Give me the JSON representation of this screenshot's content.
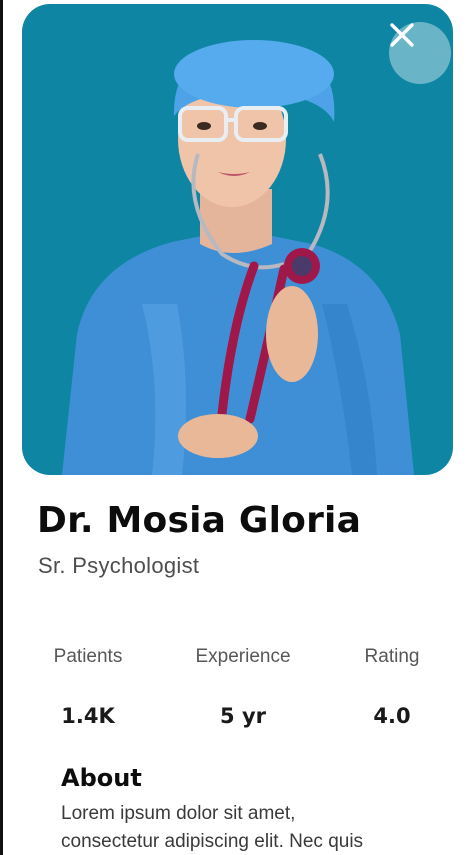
{
  "colors": {
    "hero_bg": "#0e86a3",
    "text_primary": "#0c0c0c",
    "text_secondary": "#4d4d4d"
  },
  "hero": {
    "image": "doctor-with-stethoscope",
    "close_icon": "close-icon"
  },
  "doctor": {
    "name": "Dr. Mosia Gloria",
    "title": "Sr. Psychologist"
  },
  "stats": [
    {
      "label": "Patients",
      "value": "1.4K"
    },
    {
      "label": "Experience",
      "value": "5 yr"
    },
    {
      "label": "Rating",
      "value": "4.0"
    }
  ],
  "about": {
    "heading": "About",
    "line1": "Lorem ipsum dolor sit amet,",
    "line2": "consectetur adipiscing elit. Nec quis"
  }
}
